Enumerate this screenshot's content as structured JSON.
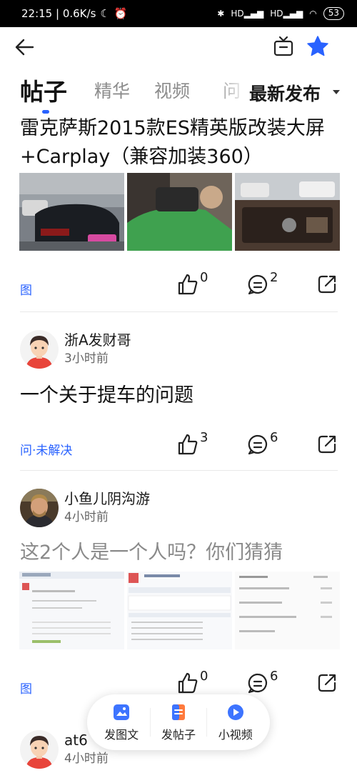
{
  "status_bar": {
    "time_speed": "22:15 | 0.6K/s",
    "battery": "53",
    "signal1": "HD",
    "signal2": "HD"
  },
  "nav": {
    "back_icon": "back-arrow-icon",
    "tv_icon": "tv-icon",
    "star_icon": "star-icon",
    "accent": "#2962ff"
  },
  "tabs": {
    "items": [
      "帖子",
      "精华",
      "视频",
      "问"
    ],
    "active": "帖子",
    "sort_label": "最新发布"
  },
  "posts": [
    {
      "title": "雷克萨斯2015款ES精英版改装大屏+Carplay（兼容加装360）",
      "tag": "图",
      "likes": "0",
      "comments": "2"
    },
    {
      "user": "浙A发财哥",
      "time": "3小时前",
      "title": "一个关于提车的问题",
      "tag": "问·未解决",
      "likes": "3",
      "comments": "6"
    },
    {
      "user": "小鱼儿阴沟游",
      "time": "4小时前",
      "title": "这2个人是一个人吗？你们猜猜",
      "tag": "图",
      "likes": "0",
      "comments": "6"
    },
    {
      "user": "at6",
      "time": "4小时前"
    }
  ],
  "fab": {
    "items": [
      {
        "label": "发图文",
        "icon": "image-text-icon"
      },
      {
        "label": "发帖子",
        "icon": "post-icon"
      },
      {
        "label": "小视频",
        "icon": "video-icon"
      }
    ]
  }
}
